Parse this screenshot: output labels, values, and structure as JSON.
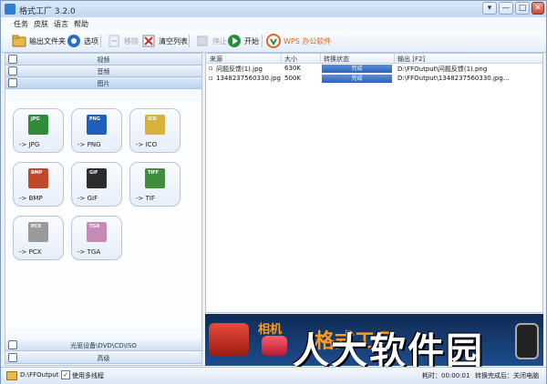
{
  "window": {
    "title": "格式工厂 3.2.0",
    "controls": [
      "▾",
      "—",
      "□",
      "✕"
    ]
  },
  "menu": [
    "任务",
    "皮肤",
    "语言",
    "帮助"
  ],
  "toolbar": {
    "output_folder": "输出文件夹",
    "options": "选项",
    "remove": "移除",
    "clear_list": "清空列表",
    "stop": "停止",
    "start": "开始",
    "wps": "WPS 办公软件"
  },
  "categories": {
    "video": "视频",
    "audio": "音频",
    "image": "图片",
    "optical": "光驱设备\\DVD\\CD\\ISO",
    "advanced": "高级"
  },
  "tiles": [
    {
      "badge": "JPG",
      "label": "-> JPG",
      "color": "#2e8b3a"
    },
    {
      "badge": "PNG",
      "label": "-> PNG",
      "color": "#1f5fb8"
    },
    {
      "badge": "ICO",
      "label": "-> ICO",
      "color": "#d8b23a"
    },
    {
      "badge": "BMP",
      "label": "-> BMP",
      "color": "#c0492b"
    },
    {
      "badge": "GIF",
      "label": "-> GIF",
      "color": "#2c2c2c"
    },
    {
      "badge": "TIFF",
      "label": "-> TIF",
      "color": "#3f8e3c"
    },
    {
      "badge": "PCX",
      "label": "-> PCX",
      "color": "#9a9a9a"
    },
    {
      "badge": "TGA",
      "label": "-> TGA",
      "color": "#c58ab6"
    }
  ],
  "table": {
    "headers": [
      "来源",
      "大小",
      "转换状态",
      "输出 [F2]"
    ],
    "rows": [
      {
        "source": "问题反馈(1).jpg",
        "size": "630K",
        "status": "完成",
        "output": "D:\\FFOutput\\问题反馈(1).png"
      },
      {
        "source": "1348237560330.jpg",
        "size": "500K",
        "status": "完成",
        "output": "D:\\FFOutput\\1348237560330.jpg..."
      }
    ]
  },
  "banner": {
    "camera_label": "相机",
    "mid_text": "格式工厂"
  },
  "watermark": "人大软件园",
  "statusbar": {
    "output_path": "D:\\FFOutput",
    "checkbox_mark": "✓",
    "multithread": "使用多线程",
    "elapsed": "耗时：00:00:01",
    "after_convert": "转换完成后：关闭电脑"
  }
}
